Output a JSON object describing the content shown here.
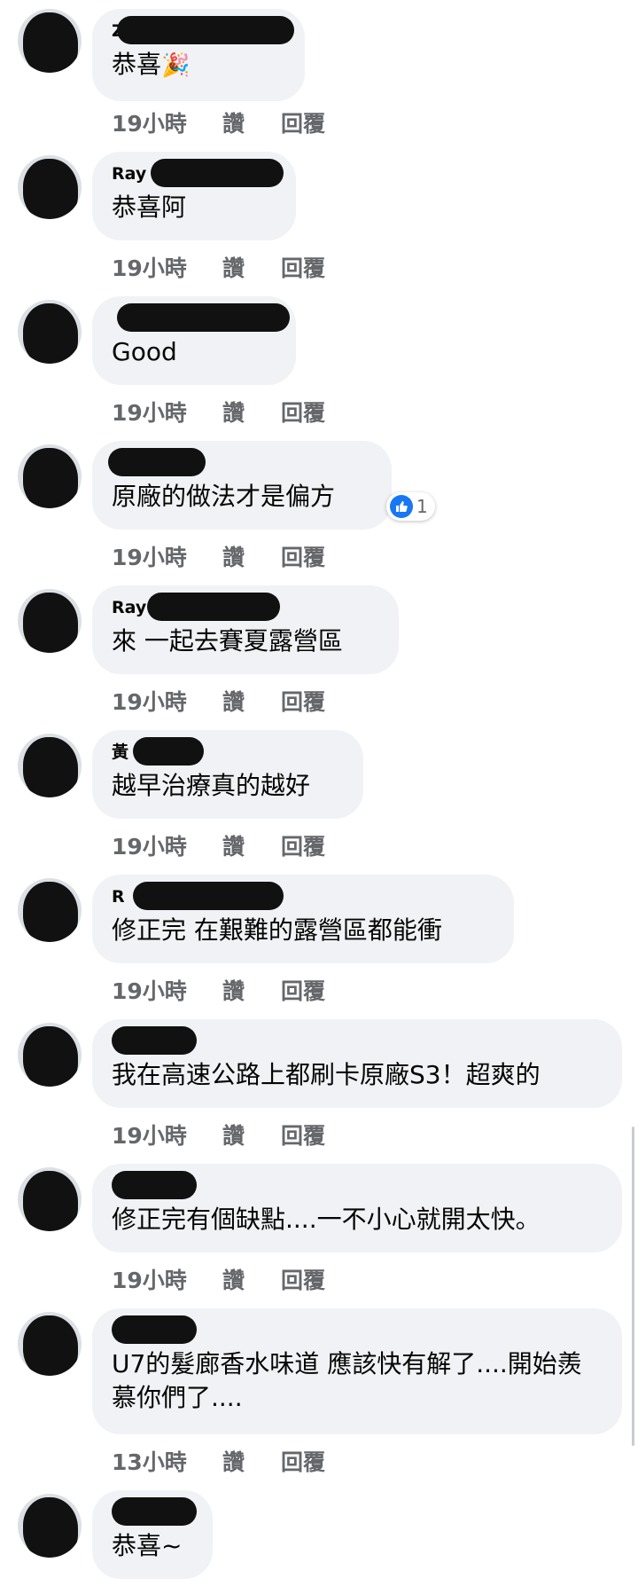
{
  "comments": [
    {
      "author": "Z",
      "text": "恭喜",
      "emoji": "🎉",
      "time": "19小時",
      "like": "讚",
      "reply": "回覆"
    },
    {
      "author": "Ray",
      "text": "恭喜阿",
      "time": "19小時",
      "like": "讚",
      "reply": "回覆"
    },
    {
      "author": "",
      "text": "Good",
      "time": "19小時",
      "like": "讚",
      "reply": "回覆"
    },
    {
      "author": "",
      "text": "原廠的做法才是偏方",
      "time": "19小時",
      "like": "讚",
      "reply": "回覆",
      "reaction_count": "1"
    },
    {
      "author": "Ray",
      "text": "來 一起去賽夏露營區",
      "time": "19小時",
      "like": "讚",
      "reply": "回覆"
    },
    {
      "author": "黃",
      "text": "越早治療真的越好",
      "time": "19小時",
      "like": "讚",
      "reply": "回覆"
    },
    {
      "author": "R",
      "text": "修正完 在艱難的露營區都能衝",
      "time": "19小時",
      "like": "讚",
      "reply": "回覆"
    },
    {
      "author": "",
      "text": "我在高速公路上都刷卡原廠S3！超爽的",
      "time": "19小時",
      "like": "讚",
      "reply": "回覆"
    },
    {
      "author": "",
      "text": "修正完有個缺點....一不小心就開太快。",
      "time": "19小時",
      "like": "讚",
      "reply": "回覆"
    },
    {
      "author": "",
      "text": "U7的髮廊香水味道 應該快有解了....開始羨慕你們了....",
      "time": "13小時",
      "like": "讚",
      "reply": "回覆"
    },
    {
      "author": "",
      "text": "恭喜~",
      "time": "",
      "like": "",
      "reply": ""
    }
  ],
  "colors": {
    "bubble": "#f0f2f5",
    "meta_text": "#65676b",
    "like_blue": "#1877f2"
  }
}
